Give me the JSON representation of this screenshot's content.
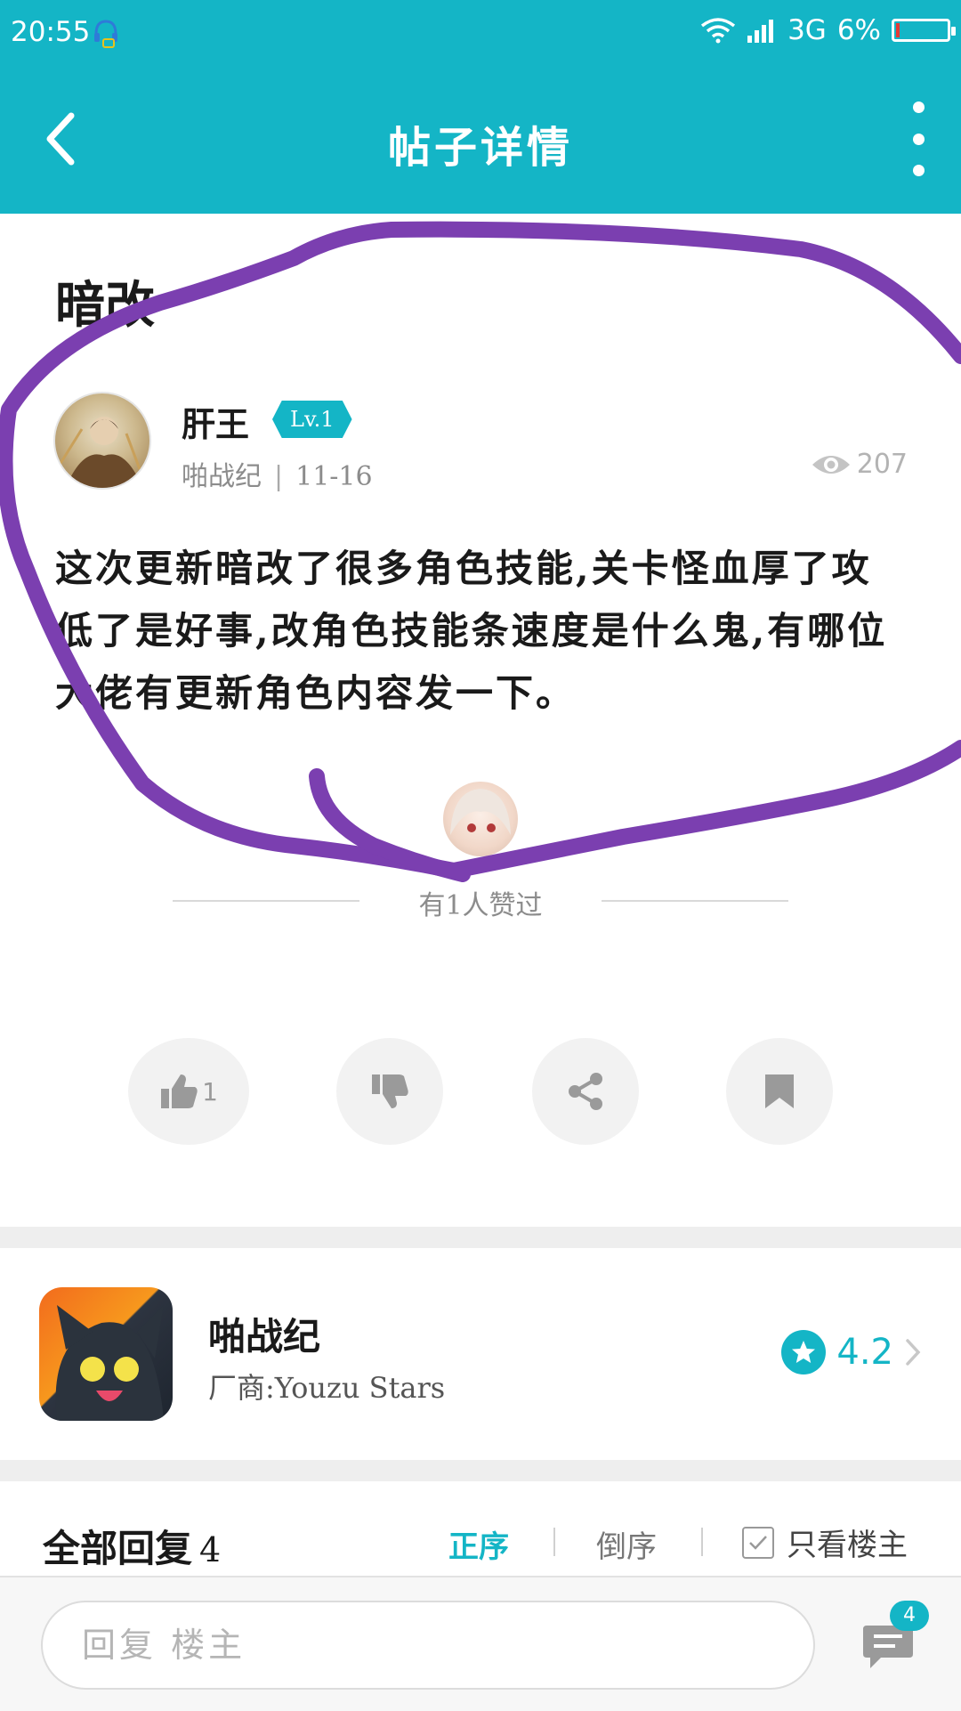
{
  "status_bar": {
    "time": "20:55",
    "network": "3G",
    "battery": "6%"
  },
  "header": {
    "title": "帖子详情"
  },
  "post": {
    "title": "暗改",
    "author": "肝王",
    "level": "Lv.1",
    "game": "啪战纪",
    "date": "11-16",
    "views": "207",
    "content": "这次更新暗改了很多角色技能,关卡怪血厚了攻低了是好事,改角色技能条速度是什么鬼,有哪位大佬有更新角色内容发一下。",
    "likes_text": "有1人赞过"
  },
  "actions": {
    "like_count": "1"
  },
  "game_card": {
    "name": "啪战纪",
    "vendor": "厂商:Youzu Stars",
    "rating": "4.2"
  },
  "replies": {
    "title": "全部回复",
    "count": "4",
    "sort_asc": "正序",
    "sort_desc": "倒序",
    "only_owner": "只看楼主"
  },
  "bottom_bar": {
    "reply_placeholder": "回复 楼主",
    "comment_badge": "4"
  },
  "colors": {
    "accent": "#14b5c6",
    "annotation": "#7b3fb0"
  }
}
